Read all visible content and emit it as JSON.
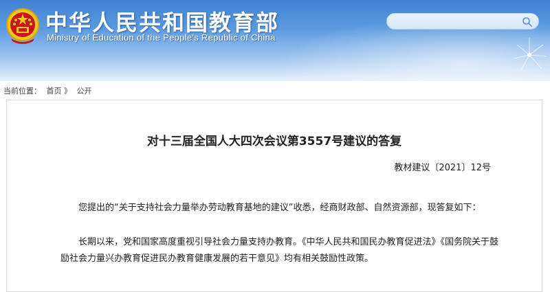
{
  "header": {
    "title": "中华人民共和国教育部",
    "subtitle": "Ministry of Education of the People's Republic of China",
    "emblem_icon": "national-emblem-icon"
  },
  "search": {
    "placeholder": "",
    "icon": "search-icon"
  },
  "breadcrumb": {
    "prefix": "当前位置：",
    "items": [
      "首页",
      "公开"
    ],
    "separator": "》"
  },
  "document": {
    "title": "对十三届全国人大四次会议第3557号建议的答复",
    "number": "教材建议〔2021〕12号",
    "paragraphs": [
      "您提出的“关于支持社会力量举办劳动教育基地的建议”收悉，经商财政部、自然资源部，现答复如下：",
      "长期以来，党和国家高度重视引导社会力量支持办教育。《中华人民共和国民办教育促进法》《国务院关于鼓励社会力量兴办教育促进民办教育健康发展的若干意见》均有相关鼓励性政策。"
    ]
  },
  "colors": {
    "header_top": "#3f82d2",
    "header_bottom": "#e8f1fb",
    "emblem_red": "#c8161d",
    "emblem_gold": "#f3c51f",
    "border": "#d9d9d9"
  }
}
